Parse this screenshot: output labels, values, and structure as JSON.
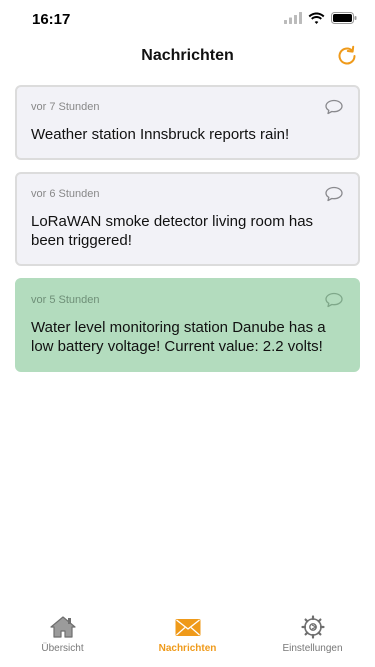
{
  "status_bar": {
    "time": "16:17"
  },
  "header": {
    "title": "Nachrichten"
  },
  "messages": [
    {
      "time": "vor 7 Stunden",
      "text": "Weather station Innsbruck reports rain!"
    },
    {
      "time": "vor 6 Stunden",
      "text": "LoRaWAN smoke detector living room has been triggered!"
    },
    {
      "time": "vor 5 Stunden",
      "text": "Water level monitoring station Danube has a low battery voltage! Current value: 2.2 volts!"
    }
  ],
  "tabs": [
    {
      "label": "Übersicht",
      "icon": "home-icon"
    },
    {
      "label": "Nachrichten",
      "icon": "envelope-icon"
    },
    {
      "label": "Einstellungen",
      "icon": "gear-icon"
    }
  ],
  "colors": {
    "accent": "#ef9a1a",
    "card_bg": "#f2f2f7",
    "card_highlight_bg": "#b3dcbe"
  }
}
